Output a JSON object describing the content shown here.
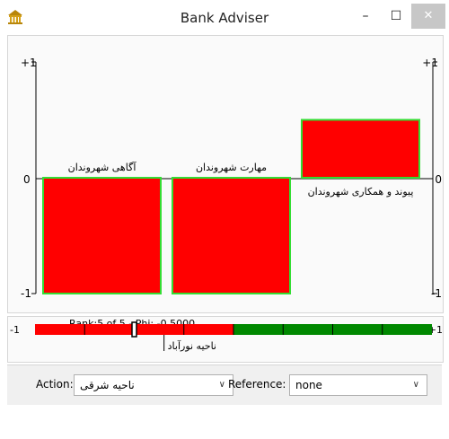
{
  "window": {
    "title": "Bank Adviser",
    "minimize": "–",
    "maximize": "☐",
    "close": "✕"
  },
  "chart_data": {
    "type": "bar",
    "categories": [
      "آگاهی شهروندان",
      "مهارت شهروندان",
      "پیوند و همکاری شهروندان"
    ],
    "values": [
      -1,
      -1,
      0.5
    ],
    "ylim": [
      -1,
      1
    ],
    "yticks_left": [
      "+1",
      "0",
      "-1"
    ],
    "yticks_right": [
      "+1",
      "0",
      "-1"
    ],
    "colors": {
      "fill": "#ff0000",
      "stroke": "#33dd33"
    }
  },
  "scale": {
    "rank_text": "Rank:5 of 5 - Phi: -0,5000",
    "min_label": "-1",
    "max_label": "+1",
    "phi": -0.5,
    "ref_value": -0.35,
    "ref_label": "ناحیه نورآباد",
    "neg_color": "#ff0000",
    "pos_color": "#008800"
  },
  "controls": {
    "action_label": "Action:",
    "action_value": "ناحیه شرقی",
    "reference_label": "Reference:",
    "reference_value": "none",
    "chevron": "∨"
  }
}
